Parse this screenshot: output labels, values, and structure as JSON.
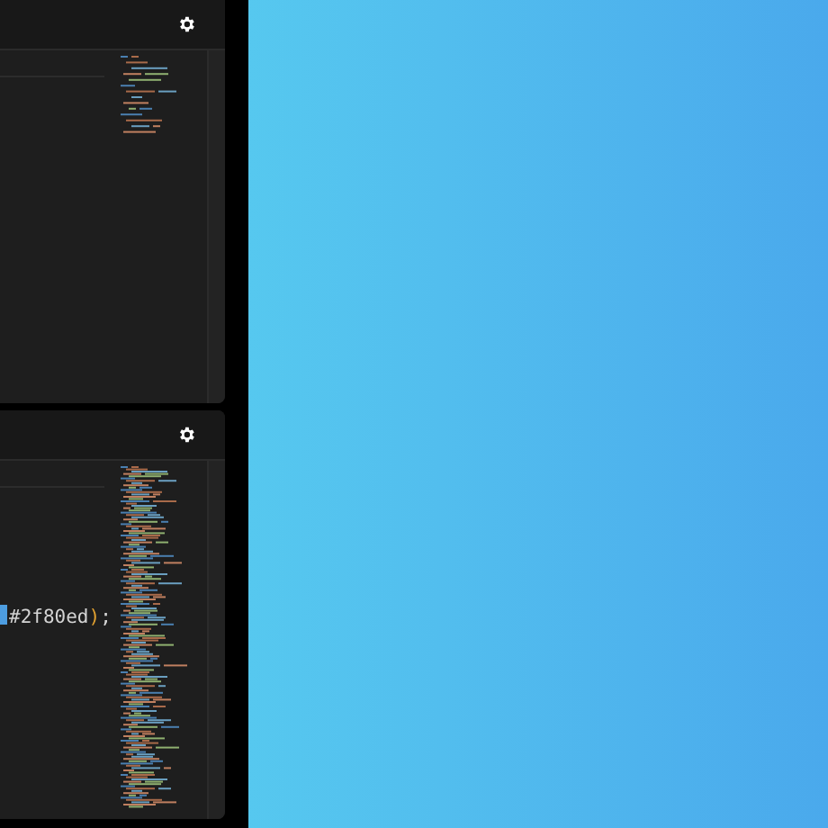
{
  "editors": [
    {
      "kind": "sparse"
    },
    {
      "kind": "dense",
      "code_tokens": [
        {
          "text": "#2f80ed",
          "kind": "value"
        },
        {
          "text": ")",
          "kind": "paren"
        },
        {
          "text": ";",
          "kind": "punct"
        }
      ]
    }
  ]
}
